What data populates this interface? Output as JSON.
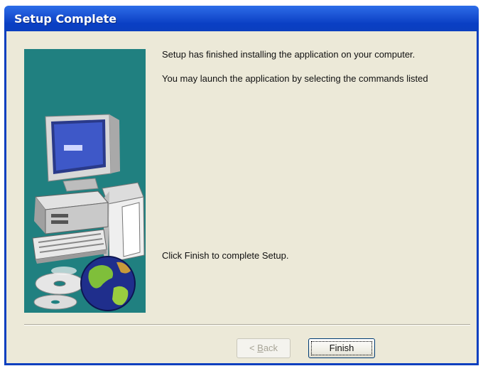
{
  "window": {
    "title": "Setup Complete"
  },
  "content": {
    "line1": "Setup has finished installing the application on your computer.",
    "line2": "You may launch the application by selecting the commands listed",
    "line3": "Click Finish to complete Setup."
  },
  "buttons": {
    "back_label_prefix": "< ",
    "back_label_accel": "B",
    "back_label_rest": "ack",
    "back_enabled": "false",
    "finish_label": "Finish"
  },
  "colors": {
    "title_bar": "#0b3fbf",
    "dialog_background": "#ece9d8",
    "art_background": "#208080"
  },
  "icons": {
    "illustration": "computer-cd-globe-illustration"
  }
}
